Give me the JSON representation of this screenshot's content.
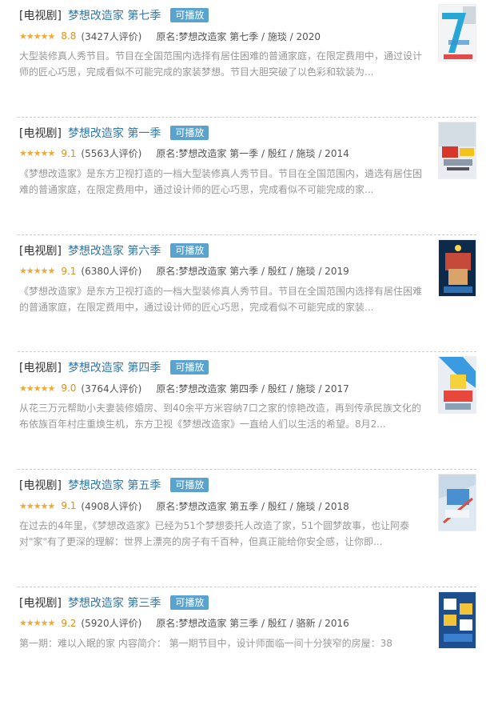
{
  "items": [
    {
      "category": "[电视剧]",
      "title": "梦想改造家 第七季",
      "badge": "可播放",
      "stars": "★★★★★",
      "score": "8.8",
      "votes": "(3427人评价)",
      "meta": "原名:梦想改造家 第七季 / 施琰 / 2020",
      "abstract": "大型装修真人秀节目。节目在全国范围内选择有居住困难的普通家庭，在限定费用中，通过设计师的匠心巧思，完成看似不可能完成的家装梦想。节目大胆突破了以色彩和软装为..."
    },
    {
      "category": "[电视剧]",
      "title": "梦想改造家 第一季",
      "badge": "可播放",
      "stars": "★★★★★",
      "score": "9.1",
      "votes": "(5563人评价)",
      "meta": "原名:梦想改造家 第一季 / 殷红 / 施琰 / 2014",
      "abstract": "《梦想改造家》是东方卫视打造的一档大型装修真人秀节目。节目在全国范围内，遴选有居住困难的普通家庭，在限定费用中，通过设计师的匠心巧思，完成看似不可能完成的家..."
    },
    {
      "category": "[电视剧]",
      "title": "梦想改造家 第六季",
      "badge": "可播放",
      "stars": "★★★★★",
      "score": "9.1",
      "votes": "(6380人评价)",
      "meta": "原名:梦想改造家 第六季 / 殷红 / 施琰 / 2019",
      "abstract": "《梦想改造家》是东方卫视打造的一档大型装修真人秀节目。节目在全国范围内选择有居住困难的普通家庭，在限定费用中，通过设计师的匠心巧思，完成看似不可能完成的家装..."
    },
    {
      "category": "[电视剧]",
      "title": "梦想改造家 第四季",
      "badge": "可播放",
      "stars": "★★★★★",
      "score": "9.0",
      "votes": "(3764人评价)",
      "meta": "原名:梦想改造家 第四季 / 殷红 / 施琰 / 2017",
      "abstract": "从花三万元帮助小夫妻装修婚房、到40余平方米容纳7口之家的惊艳改造，再到传承民族文化的布依族百年村庄重焕生机，东方卫视《梦想改造家》一直给人们以生活的希望。8月2..."
    },
    {
      "category": "[电视剧]",
      "title": "梦想改造家 第五季",
      "badge": "可播放",
      "stars": "★★★★★",
      "score": "9.1",
      "votes": "(4908人评价)",
      "meta": "原名:梦想改造家 第五季 / 殷红 / 施琰 / 2018",
      "abstract": "在过去的4年里，《梦想改造家》已经为51个梦想委托人改造了家，51个圆梦故事，也让阿泰对\"家\"有了更深的理解：世界上漂亮的房子有千百种，但真正能给你安全感，让你即..."
    },
    {
      "category": "[电视剧]",
      "title": "梦想改造家 第三季",
      "badge": "可播放",
      "stars": "★★★★★",
      "score": "9.2",
      "votes": "(5920人评价)",
      "meta": "原名:梦想改造家 第三季 / 殷红 / 骆新 / 2016",
      "abstract": "第一期：难以入眠的家 内容简介： 第一期节目中，设计师面临一间十分狭窄的房屋：38"
    }
  ]
}
